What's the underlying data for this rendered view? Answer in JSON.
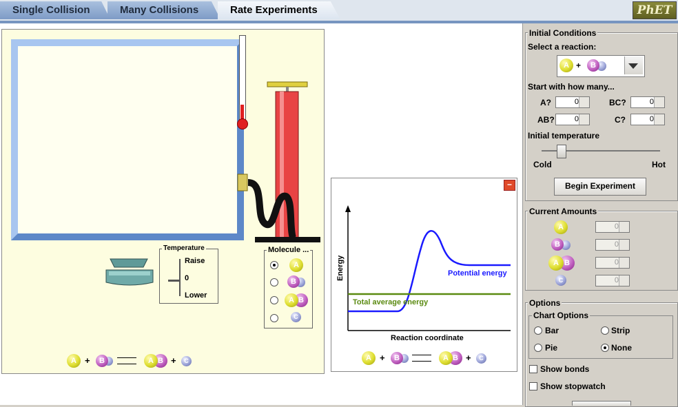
{
  "tabs": [
    {
      "label": "Single Collision",
      "active": false
    },
    {
      "label": "Many Collisions",
      "active": false
    },
    {
      "label": "Rate Experiments",
      "active": true
    }
  ],
  "logo": "PhET",
  "temperature_control": {
    "title": "Temperature",
    "raise": "Raise",
    "zero": "0",
    "lower": "Lower"
  },
  "molecule_selector": {
    "title": "Molecule ...",
    "options": [
      "A",
      "BC",
      "AB",
      "C"
    ],
    "selected": "A"
  },
  "energy_chart": {
    "ylabel": "Energy",
    "xlabel": "Reaction coordinate",
    "potential_label": "Potential energy",
    "total_label": "Total average energy",
    "colors": {
      "potential": "#1a1aff",
      "total": "#5a8a10"
    }
  },
  "chart_data": {
    "type": "line",
    "title": "",
    "xlabel": "Reaction coordinate",
    "ylabel": "Energy",
    "series": [
      {
        "name": "Potential energy"
      },
      {
        "name": "Total average energy"
      }
    ]
  },
  "reaction_legend": {
    "left1": "A",
    "left2": "BC",
    "right1": "AB",
    "right2": "C",
    "plus": "+"
  },
  "initial_conditions": {
    "title": "Initial Conditions",
    "select_label": "Select a reaction:",
    "selected_reaction": "A + BC",
    "start_label": "Start with how many...",
    "counts": [
      {
        "label": "A?",
        "value": "0"
      },
      {
        "label": "BC?",
        "value": "0"
      },
      {
        "label": "AB?",
        "value": "0"
      },
      {
        "label": "C?",
        "value": "0"
      }
    ],
    "temp_label": "Initial temperature",
    "temp_level": 0.14,
    "cold": "Cold",
    "hot": "Hot",
    "begin_button": "Begin Experiment"
  },
  "current_amounts": {
    "title": "Current Amounts",
    "rows": [
      {
        "mol": "A",
        "value": "0"
      },
      {
        "mol": "BC",
        "value": "0"
      },
      {
        "mol": "AB",
        "value": "0"
      },
      {
        "mol": "C",
        "value": "0"
      }
    ]
  },
  "options": {
    "title": "Options",
    "chart_title": "Chart Options",
    "chart_choices": [
      {
        "label": "Bar",
        "selected": false
      },
      {
        "label": "Strip",
        "selected": false
      },
      {
        "label": "Pie",
        "selected": false
      },
      {
        "label": "None",
        "selected": true
      }
    ],
    "show_bonds": "Show bonds",
    "show_stopwatch": "Show stopwatch"
  },
  "colors": {
    "accent": "#7795c0",
    "pump": "#e84444",
    "box_border": "#6e9ad6"
  }
}
